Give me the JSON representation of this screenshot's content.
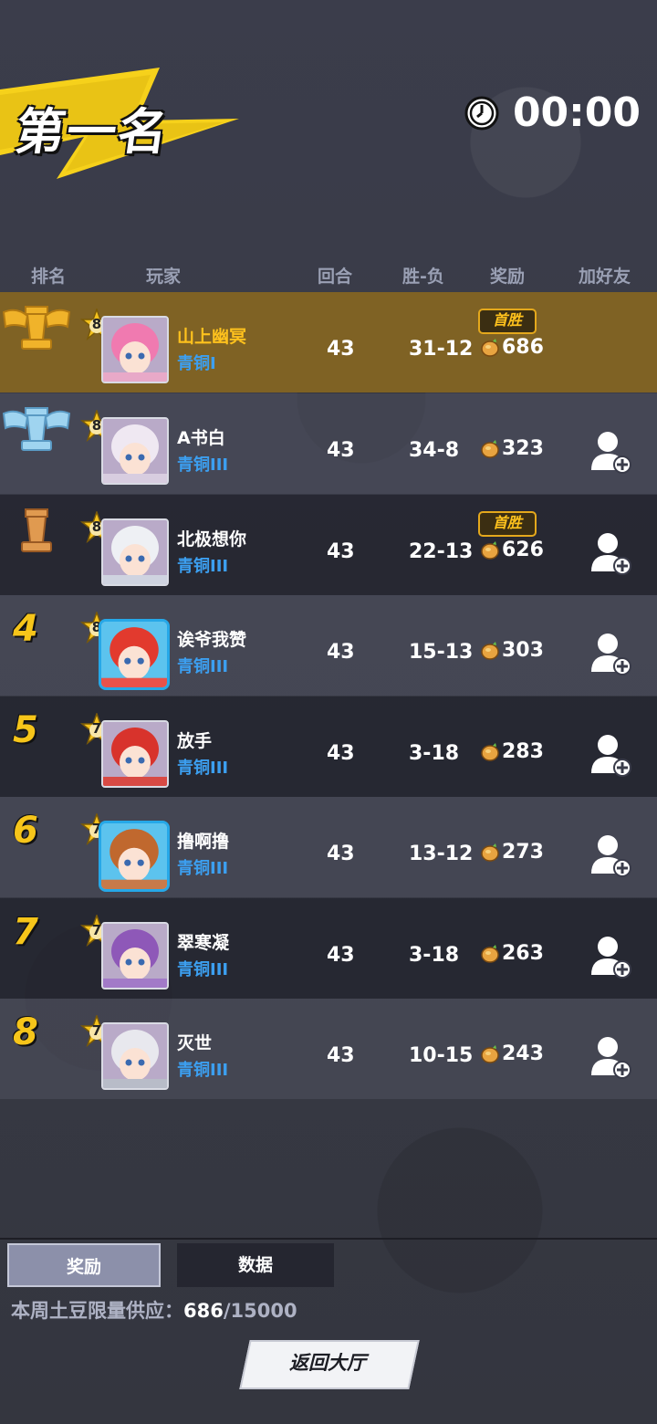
{
  "title": "第一名",
  "timer": "00:00",
  "headers": {
    "rank": "排名",
    "player": "玩家",
    "rounds": "回合",
    "wl": "胜-负",
    "reward": "奖励",
    "add_friend": "加好友"
  },
  "first_win_label": "首胜",
  "rows": [
    {
      "rank": "1",
      "level": "8",
      "name": "山上幽冥",
      "tier": "青铜I",
      "rounds": "43",
      "wl": "31-12",
      "reward": "686",
      "first_win": true,
      "friend": false
    },
    {
      "rank": "2",
      "level": "8",
      "name": "A书白",
      "tier": "青铜III",
      "rounds": "43",
      "wl": "34-8",
      "reward": "323",
      "first_win": false,
      "friend": true
    },
    {
      "rank": "3",
      "level": "8",
      "name": "北极想你",
      "tier": "青铜III",
      "rounds": "43",
      "wl": "22-13",
      "reward": "626",
      "first_win": true,
      "friend": true
    },
    {
      "rank": "4",
      "level": "8",
      "name": "诶爷我赞",
      "tier": "青铜III",
      "rounds": "43",
      "wl": "15-13",
      "reward": "303",
      "first_win": false,
      "friend": true
    },
    {
      "rank": "5",
      "level": "7",
      "name": "放手",
      "tier": "青铜III",
      "rounds": "43",
      "wl": "3-18",
      "reward": "283",
      "first_win": false,
      "friend": true
    },
    {
      "rank": "6",
      "level": "7",
      "name": "撸啊撸",
      "tier": "青铜III",
      "rounds": "43",
      "wl": "13-12",
      "reward": "273",
      "first_win": false,
      "friend": true
    },
    {
      "rank": "7",
      "level": "7",
      "name": "翠寒凝",
      "tier": "青铜III",
      "rounds": "43",
      "wl": "3-18",
      "reward": "263",
      "first_win": false,
      "friend": true
    },
    {
      "rank": "8",
      "level": "7",
      "name": "灭世",
      "tier": "青铜III",
      "rounds": "43",
      "wl": "10-15",
      "reward": "243",
      "first_win": false,
      "friend": true
    }
  ],
  "tabs": {
    "reward": "奖励",
    "data": "数据"
  },
  "supply": {
    "label": "本周土豆限量供应：",
    "current": "686",
    "total": "/15000"
  },
  "back_button": "返回大厅",
  "colors": {
    "gold": "#ffc21d",
    "tier_blue": "#3c9ff0",
    "first_row": "#7f6224"
  }
}
